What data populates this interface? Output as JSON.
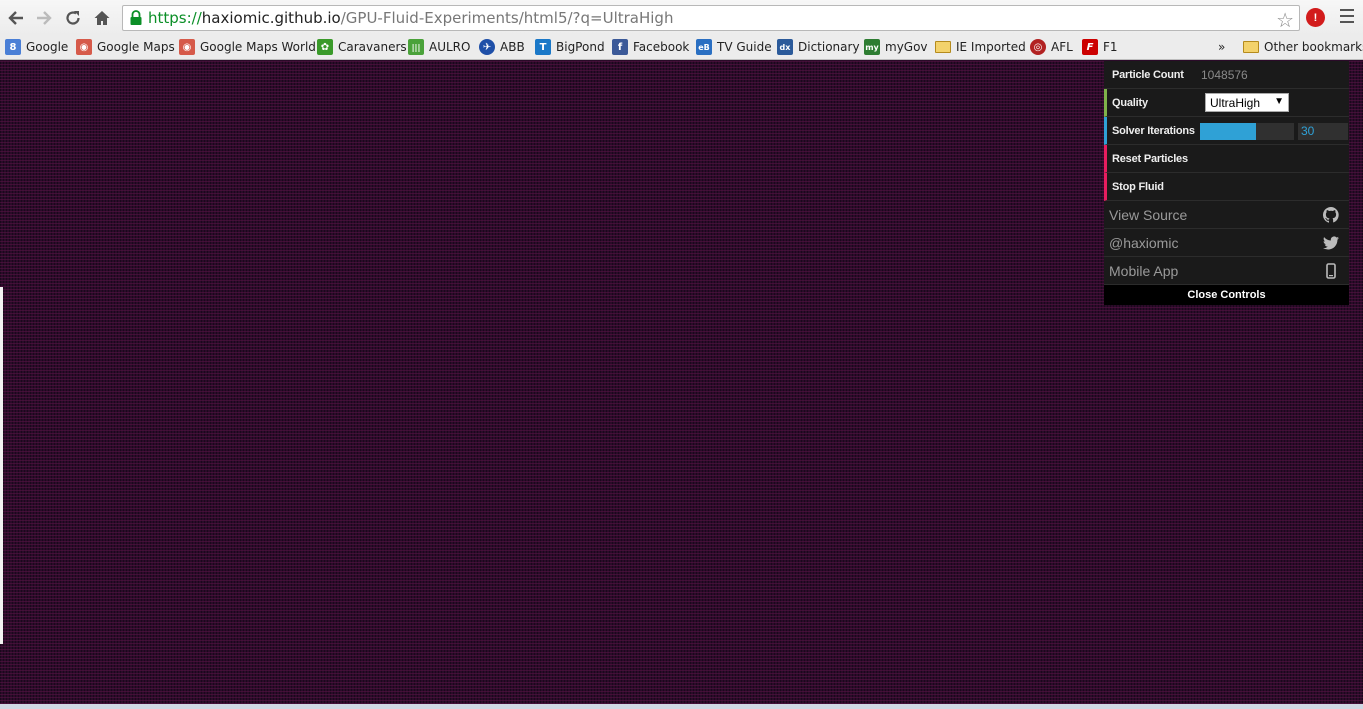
{
  "browser": {
    "url_scheme": "https://",
    "url_host": "haxiomic.github.io",
    "url_path": "/GPU-Fluid-Experiments/html5/?q=UltraHigh",
    "ext_label": "!",
    "overflow_label": "»",
    "bookmarks": [
      {
        "label": "Google",
        "icon": "google-icon",
        "color": "#4a7fd6",
        "glyph": "8"
      },
      {
        "label": "Google Maps",
        "icon": "maps-pin-icon",
        "color": "#d65a4a",
        "glyph": "◉"
      },
      {
        "label": "Google Maps World",
        "icon": "maps-pin-icon",
        "color": "#d65a4a",
        "glyph": "◉"
      },
      {
        "label": "Caravaners",
        "icon": "caravaners-icon",
        "color": "#3a9a2a",
        "glyph": "✿"
      },
      {
        "label": "AULRO",
        "icon": "aulro-icon",
        "color": "#4aa23a",
        "glyph": "|||"
      },
      {
        "label": "ABB",
        "icon": "abb-icon",
        "color": "#1e4fa8",
        "glyph": "✈"
      },
      {
        "label": "BigPond",
        "icon": "telstra-icon",
        "color": "#1a78c8",
        "glyph": "T"
      },
      {
        "label": "Facebook",
        "icon": "facebook-icon",
        "color": "#3b5998",
        "glyph": "f"
      },
      {
        "label": "TV Guide",
        "icon": "tvguide-icon",
        "color": "#2a6fc2",
        "glyph": "eB"
      },
      {
        "label": "Dictionary",
        "icon": "dictionary-icon",
        "color": "#2b5a9a",
        "glyph": "dx"
      },
      {
        "label": "myGov",
        "icon": "mygov-icon",
        "color": "#2e7d32",
        "glyph": "my"
      },
      {
        "label": "IE Imported",
        "icon": "folder-icon",
        "color": "#f3d26b",
        "glyph": ""
      },
      {
        "label": "AFL",
        "icon": "afl-icon",
        "color": "#b22222",
        "glyph": "◎"
      },
      {
        "label": "F1",
        "icon": "f1-icon",
        "color": "#cc0000",
        "glyph": "F"
      }
    ],
    "other_bookmarks": "Other bookmarks"
  },
  "panel": {
    "particle_count_label": "Particle Count",
    "particle_count_value": "1048576",
    "quality_label": "Quality",
    "quality_value": "UltraHigh",
    "solver_label": "Solver Iterations",
    "solver_value": "30",
    "solver_fill_fraction": 0.6,
    "reset_label": "Reset Particles",
    "stop_label": "Stop Fluid",
    "view_source_label": "View Source",
    "twitter_label": "@haxiomic",
    "mobile_label": "Mobile App",
    "close_label": "Close Controls"
  },
  "colors": {
    "canvas_bg": "#2b0b29",
    "panel_bg": "#1a1a1a",
    "accent_blue": "#2fa1d6",
    "accent_green": "#7fb24a",
    "accent_red": "#e61d5f"
  }
}
